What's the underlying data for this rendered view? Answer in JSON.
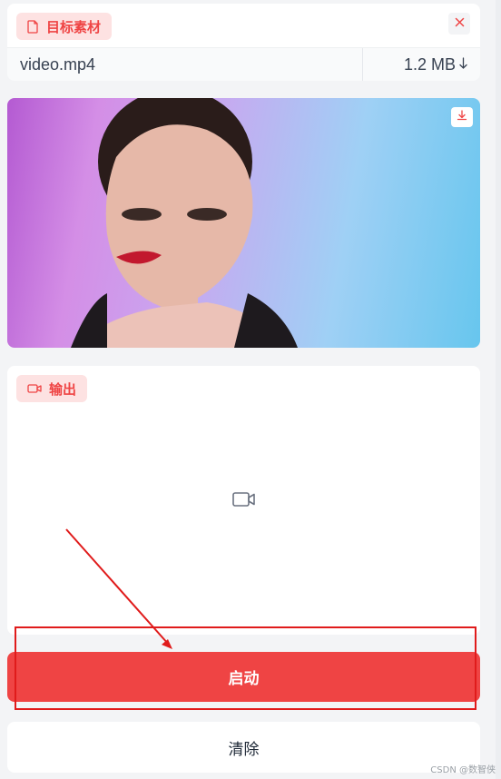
{
  "input_panel": {
    "badge_label": "目标素材",
    "file_name": "video.mp4",
    "file_size": "1.2 MB"
  },
  "output_panel": {
    "badge_label": "输出"
  },
  "actions": {
    "start_label": "启动",
    "clear_label": "清除"
  },
  "watermark": "CSDN @数智侠",
  "colors": {
    "accent": "#ef4444",
    "badge_bg": "#fde2e2",
    "annotation": "#e01b1b"
  },
  "icons": [
    "file-icon",
    "close-icon",
    "download-icon",
    "video-camera-icon"
  ]
}
